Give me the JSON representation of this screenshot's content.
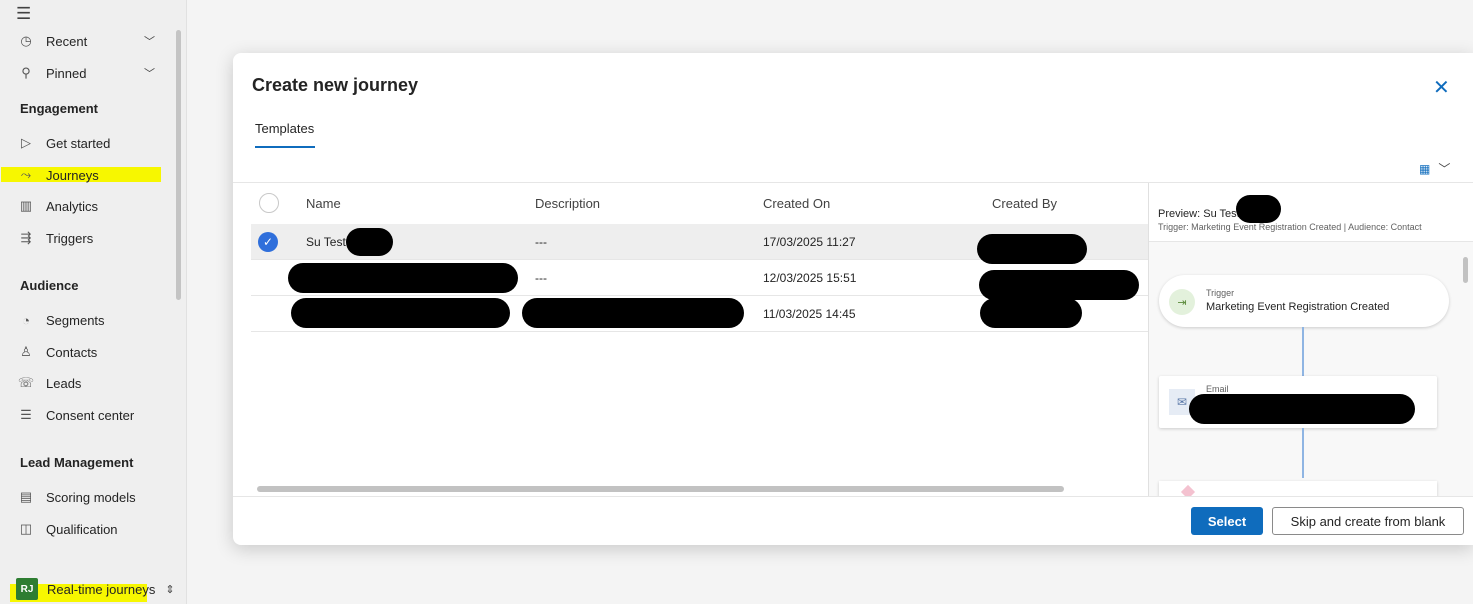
{
  "sidebar": {
    "menu_icon": "hamburger-icon",
    "recent": {
      "label": "Recent",
      "icon": "clock-icon"
    },
    "pinned": {
      "label": "Pinned",
      "icon": "pin-icon"
    },
    "sections": [
      {
        "title": "Engagement",
        "items": [
          {
            "label": "Get started",
            "icon": "play-icon"
          },
          {
            "label": "Journeys",
            "icon": "journey-icon"
          },
          {
            "label": "Analytics",
            "icon": "analytics-icon"
          },
          {
            "label": "Triggers",
            "icon": "trigger-icon"
          }
        ]
      },
      {
        "title": "Audience",
        "items": [
          {
            "label": "Segments",
            "icon": "segments-icon"
          },
          {
            "label": "Contacts",
            "icon": "person-icon"
          },
          {
            "label": "Leads",
            "icon": "leads-icon"
          },
          {
            "label": "Consent center",
            "icon": "consent-icon"
          }
        ]
      },
      {
        "title": "Lead Management",
        "items": [
          {
            "label": "Scoring models",
            "icon": "scoring-icon"
          },
          {
            "label": "Qualification",
            "icon": "qualification-icon"
          }
        ]
      }
    ],
    "area": {
      "badge": "RJ",
      "label": "Real-time journeys"
    },
    "highlight_color": "#f7f700"
  },
  "dialog": {
    "title": "Create new journey",
    "tabs": [
      "Templates"
    ],
    "grid": {
      "columns": [
        "Name",
        "Description",
        "Created On",
        "Created By"
      ],
      "rows": [
        {
          "name": "Su Test",
          "description": "---",
          "created_on": "17/03/2025 11:27",
          "selected": true
        },
        {
          "name": "",
          "description": "---",
          "created_on": "12/03/2025 15:51",
          "selected": false
        },
        {
          "name": "",
          "description": "",
          "created_on": "11/03/2025 14:45",
          "selected": false
        }
      ]
    },
    "preview": {
      "title": "Preview: Su Test",
      "subtitle": "Trigger: Marketing Event Registration Created | Audience: Contact",
      "trigger_label": "Trigger",
      "trigger_name": "Marketing Event Registration Created",
      "email_label": "Email"
    },
    "buttons": {
      "select": "Select",
      "skip": "Skip and create from blank"
    },
    "accent_color": "#0f6cbd"
  }
}
